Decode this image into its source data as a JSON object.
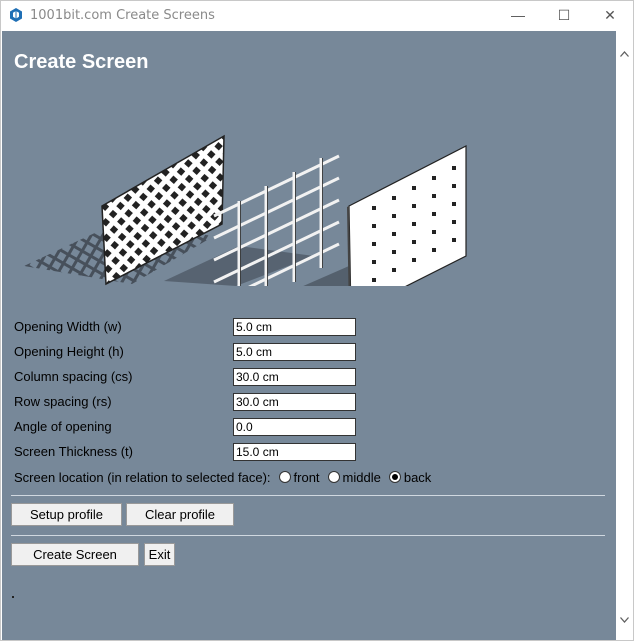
{
  "window": {
    "title": "1001bit.com Create Screens",
    "controls": {
      "minimize": "—",
      "maximize": "☐",
      "close": "✕"
    }
  },
  "page": {
    "title": "Create Screen"
  },
  "form": {
    "fields": [
      {
        "label": "Opening Width (w)",
        "value": "5.0 cm"
      },
      {
        "label": "Opening Height (h)",
        "value": "5.0 cm"
      },
      {
        "label": "Column spacing (cs)",
        "value": "30.0 cm"
      },
      {
        "label": "Row spacing (rs)",
        "value": "30.0 cm"
      },
      {
        "label": "Angle of opening",
        "value": "0.0"
      },
      {
        "label": "Screen Thickness (t)",
        "value": "15.0 cm"
      }
    ],
    "location": {
      "label": "Screen location (in relation to selected face):",
      "options": [
        "front",
        "middle",
        "back"
      ],
      "selected": "back"
    }
  },
  "buttons": {
    "setup_profile": "Setup profile",
    "clear_profile": "Clear profile",
    "create_screen": "Create Screen",
    "exit": "Exit"
  },
  "colors": {
    "background": "#778899",
    "title_text": "#ffffff",
    "button_face": "#f0f0f0"
  },
  "icons": {
    "app": "sketchup-cube-icon",
    "scroll_up": "chevron-up-icon",
    "scroll_down": "chevron-down-icon"
  }
}
